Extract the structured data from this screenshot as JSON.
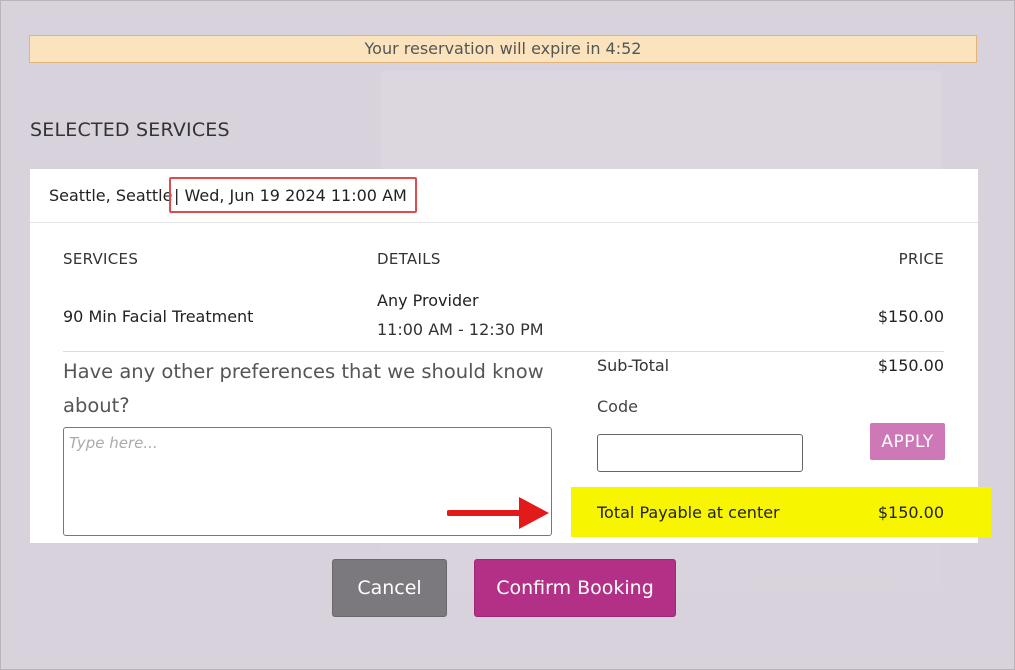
{
  "timer": {
    "text": "Your reservation will expire in 4:52"
  },
  "section": {
    "title": "SELECTED SERVICES"
  },
  "booking": {
    "location": "Seattle, Seattle",
    "datetime": "| Wed, Jun 19 2024 11:00 AM"
  },
  "table": {
    "headers": {
      "services": "SERVICES",
      "details": "DETAILS",
      "price": "PRICE"
    },
    "rows": [
      {
        "service": "90 Min Facial Treatment",
        "provider": "Any Provider",
        "time": "11:00 AM - 12:30 PM",
        "price": "$150.00"
      }
    ]
  },
  "preferences": {
    "question": "Have any other preferences that we should know about?",
    "placeholder": "Type here..."
  },
  "summary": {
    "subtotal_label": "Sub-Total",
    "subtotal_value": "$150.00",
    "code_label": "Code",
    "apply_label": "APPLY",
    "total_label": "Total Payable at center",
    "total_value": "$150.00"
  },
  "actions": {
    "cancel_label": "Cancel",
    "confirm_label": "Confirm Booking"
  },
  "colors": {
    "highlight": "#f7f500",
    "annotation_red": "#e31a1a",
    "confirm": "#b23186",
    "apply": "#cf78b8"
  },
  "icons": {
    "annotation": "arrow-right-icon"
  }
}
